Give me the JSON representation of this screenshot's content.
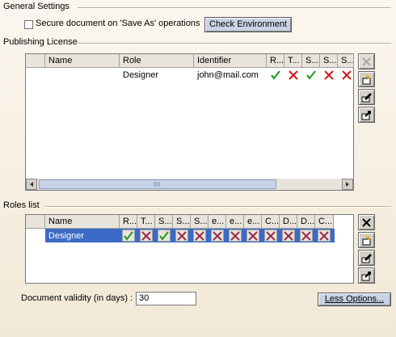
{
  "general": {
    "title": "General Settings",
    "secure_label": "Secure document on 'Save As' operations",
    "check_env_label": "Check Environment"
  },
  "publishing": {
    "title": "Publishing License",
    "columns": [
      "Name",
      "Role",
      "Identifier",
      "R...",
      "T...",
      "S...",
      "S...",
      "S..."
    ],
    "row": {
      "name": "",
      "role": "Designer",
      "identifier": "john@mail.com",
      "flags": [
        "check",
        "cross",
        "check",
        "cross",
        "cross"
      ]
    }
  },
  "roles": {
    "title": "Roles list",
    "columns": [
      "Name",
      "R...",
      "T...",
      "S...",
      "S...",
      "S...",
      "e...",
      "e...",
      "e...",
      "C...",
      "D...",
      "D...",
      "C..."
    ],
    "row": {
      "name": "Designer",
      "flags": [
        "check",
        "cross",
        "check",
        "cross",
        "cross",
        "cross",
        "cross",
        "cross",
        "cross",
        "cross",
        "cross",
        "cross"
      ]
    }
  },
  "validity": {
    "label": "Document validity (in days) :",
    "value": "30"
  },
  "less_options_label": "Less Options..."
}
